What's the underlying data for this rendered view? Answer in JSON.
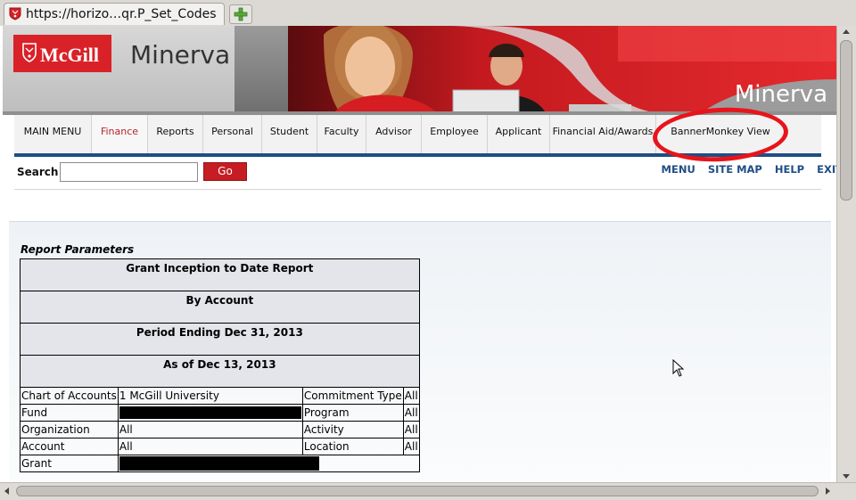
{
  "browser": {
    "tab_title": "https://horizo…qr.P_Set_Codes"
  },
  "header": {
    "logo_text": "McGill",
    "site_name": "Minerva",
    "photo_brand": "Minerva"
  },
  "nav": {
    "items": [
      {
        "label": "MAIN MENU"
      },
      {
        "label": "Finance",
        "active": true
      },
      {
        "label": "Reports"
      },
      {
        "label": "Personal"
      },
      {
        "label": "Student"
      },
      {
        "label": "Faculty"
      },
      {
        "label": "Advisor"
      },
      {
        "label": "Employee"
      },
      {
        "label": "Applicant"
      },
      {
        "label": "Financial Aid/Awards"
      },
      {
        "label": "BannerMonkey View"
      }
    ],
    "highlight_color": "#e8141b",
    "active_color": "#b5232a",
    "rule_color": "#1f4e86"
  },
  "search": {
    "label": "Search",
    "value": "",
    "go_label": "Go"
  },
  "toplinks": {
    "menu": "MENU",
    "site_map": "SITE MAP",
    "help": "HELP",
    "exit": "EXIT"
  },
  "report": {
    "section_title": "Report Parameters",
    "headers": [
      "Grant Inception to Date Report",
      "By Account",
      "Period Ending Dec 31, 2013",
      "As of Dec 13, 2013"
    ],
    "rows": [
      {
        "label1": "Chart of Accounts",
        "value1": "1 McGill University",
        "label2": "Commitment Type",
        "value2": "All"
      },
      {
        "label1": "Fund",
        "value1": "",
        "label2": "Program",
        "value2": "All"
      },
      {
        "label1": "Organization",
        "value1": "All",
        "label2": "Activity",
        "value2": "All"
      },
      {
        "label1": "Account",
        "value1": "All",
        "label2": "Location",
        "value2": "All"
      },
      {
        "label1": "Grant",
        "value1": ""
      }
    ]
  }
}
